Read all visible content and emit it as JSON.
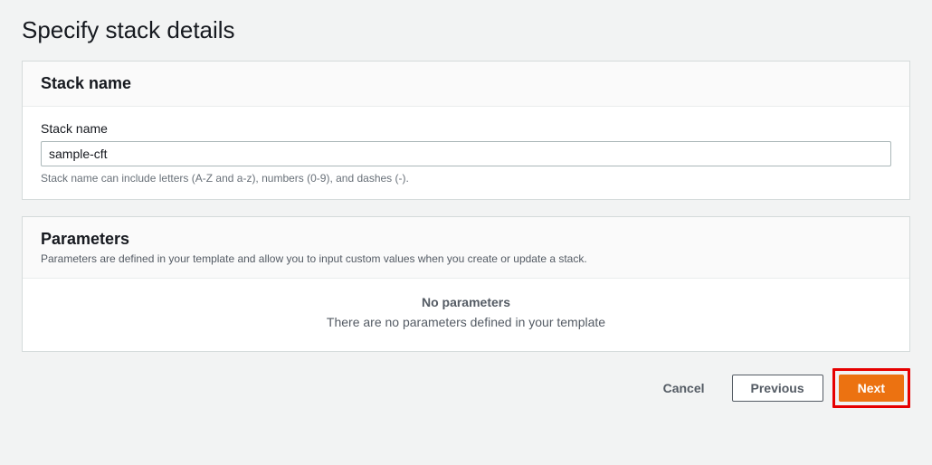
{
  "page": {
    "title": "Specify stack details"
  },
  "stack_name": {
    "panel_title": "Stack name",
    "label": "Stack name",
    "value": "sample-cft",
    "hint": "Stack name can include letters (A-Z and a-z), numbers (0-9), and dashes (-)."
  },
  "parameters": {
    "panel_title": "Parameters",
    "description": "Parameters are defined in your template and allow you to input custom values when you create or update a stack.",
    "empty_title": "No parameters",
    "empty_text": "There are no parameters defined in your template"
  },
  "footer": {
    "cancel": "Cancel",
    "previous": "Previous",
    "next": "Next"
  }
}
